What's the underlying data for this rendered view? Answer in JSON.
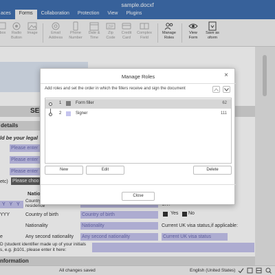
{
  "app": {
    "doc_title": "sample.docxf",
    "tabs": [
      "aces",
      "Forms",
      "Collaboration",
      "Protection",
      "View",
      "Plugins"
    ],
    "active_tab": "Forms"
  },
  "toolbar": {
    "items": [
      {
        "label": "box",
        "icon": "checkbox-icon"
      },
      {
        "label": "Radio\nButton",
        "icon": "radio-button-icon"
      },
      {
        "label": "Image",
        "icon": "image-icon"
      },
      {
        "label": "Email\nAddress",
        "icon": "at-sign-icon"
      },
      {
        "label": "Phone\nNumber",
        "icon": "phone-icon"
      },
      {
        "label": "Date &\nTime",
        "icon": "calendar-icon"
      },
      {
        "label": "Zip\nCode",
        "icon": "zip-icon"
      },
      {
        "label": "Credit\nCard",
        "icon": "credit-card-icon"
      },
      {
        "label": "Complex\nField",
        "icon": "complex-field-icon"
      },
      {
        "label": "Manage\nRoles",
        "icon": "manage-roles-icon"
      },
      {
        "label": "View\nForm",
        "icon": "view-form-icon"
      },
      {
        "label": "Save as\noform",
        "icon": "save-as-oform-icon"
      }
    ]
  },
  "document": {
    "section_fragment": "SEC",
    "details_heading": "details",
    "legal_prompt": "ld be your legal",
    "placeholder": "Please enter",
    "choose_placeholder": "Please choo",
    "etc_fragment": "etc)",
    "nation_fragment": "Natio",
    "y_values": [
      "Y",
      "Y",
      "Y"
    ],
    "yy_fragment": "YYY",
    "fragment_e": "e",
    "residence_label": "Country of\nresidence",
    "birth_label": "Country of birth",
    "birth_field": "Country of birth",
    "nationality_label": "Nationality",
    "nationality_field": "Nationality",
    "second_nat_label": "Any second nationality",
    "second_nat_field": "Any second nationality",
    "uk_question": "UK?",
    "yes_label": "Yes",
    "no_label": "No",
    "visa_status_label": "Current UK visa status,if applicable:",
    "visa_status_field": "Current UK visa status",
    "student_id_text": "D (student identifier made up of your initials\ns, e.g. jb101, please enter it here:",
    "information_heading": "nformation"
  },
  "statusbar": {
    "saved_text": "All changes saved",
    "language": "English (United States)"
  },
  "dialog": {
    "title": "Manage Roles",
    "description": "Add roles and set the order in which the fillers receive and sign the document",
    "roles": [
      {
        "num": "1",
        "name": "Form filler",
        "count": "62",
        "color": "#7a7a7a",
        "selected": true
      },
      {
        "num": "2",
        "name": "Signer",
        "count": "111",
        "color": "#c5c4ee",
        "selected": false
      }
    ],
    "new_label": "New",
    "edit_label": "Edit",
    "delete_label": "Delete",
    "close_label": "Close"
  }
}
